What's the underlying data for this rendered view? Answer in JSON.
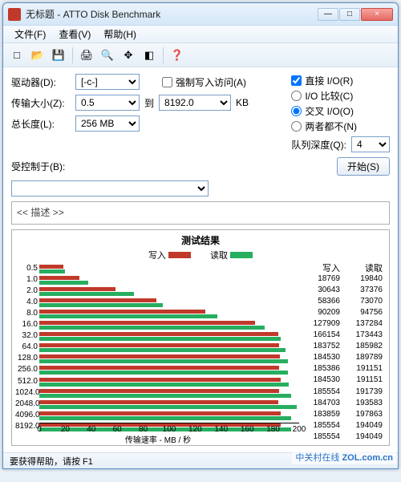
{
  "window": {
    "title": "无标题 - ATTO Disk Benchmark",
    "min": "—",
    "max": "□",
    "close": "×"
  },
  "menu": {
    "file": "文件(F)",
    "view": "查看(V)",
    "help": "帮助(H)"
  },
  "toolbar_icons": {
    "new": "□",
    "open": "📂",
    "save": "💾",
    "print": "🖨",
    "preview": "🔍",
    "move": "✥",
    "unknown": "◧",
    "about": "❓"
  },
  "form": {
    "drive_lbl": "驱动器(D):",
    "drive_val": "[-c-]",
    "xfer_lbl": "传输大小(Z):",
    "xfer_from": "0.5",
    "to_lbl": "到",
    "xfer_to": "8192.0",
    "xfer_unit": "KB",
    "len_lbl": "总长度(L):",
    "len_val": "256 MB",
    "force_write": "强制写入访问(A)",
    "direct_io": "直接 I/O(R)",
    "io_compare": "I/O 比较(C)",
    "overlapped": "交叉 I/O(O)",
    "neither": "两者都不(N)",
    "queue_lbl": "队列深度(Q):",
    "queue_val": "4",
    "controlled_lbl": "受控制于(B):",
    "controlled_val": "",
    "start_btn": "开始(S)",
    "desc_placeholder": "<< 描述 >>"
  },
  "results": {
    "title": "测试结果",
    "legend_write": "写入",
    "legend_read": "读取",
    "col_write": "写入",
    "col_read": "读取",
    "xlabel": "传输速率 - MB / 秒"
  },
  "chart_data": {
    "type": "bar",
    "xlabel": "传输速率 - MB / 秒",
    "xlim": [
      0,
      200
    ],
    "xticks": [
      0,
      20,
      40,
      60,
      80,
      100,
      120,
      140,
      160,
      180,
      200
    ],
    "categories": [
      "0.5",
      "1.0",
      "2.0",
      "4.0",
      "8.0",
      "16.0",
      "32.0",
      "64.0",
      "128.0",
      "256.0",
      "512.0",
      "1024.0",
      "2048.0",
      "4096.0",
      "8192.0"
    ],
    "series": [
      {
        "name": "写入",
        "color": "#c0392b",
        "values": [
          18.769,
          30.643,
          58.366,
          90.209,
          127.909,
          166.154,
          183.752,
          184.53,
          185.386,
          184.53,
          185.554,
          184.703,
          183.859,
          185.554,
          185.554
        ]
      },
      {
        "name": "读取",
        "color": "#27ae60",
        "values": [
          19.84,
          37.376,
          73.07,
          94.756,
          137.284,
          173.443,
          185.982,
          189.789,
          191.151,
          191.151,
          191.739,
          193.583,
          197.863,
          194.049,
          194.049
        ]
      }
    ],
    "table": {
      "write": [
        18769,
        30643,
        58366,
        90209,
        127909,
        166154,
        183752,
        184530,
        185386,
        184530,
        185554,
        184703,
        183859,
        185554,
        185554
      ],
      "read": [
        19840,
        37376,
        73070,
        94756,
        137284,
        173443,
        185982,
        189789,
        191151,
        191151,
        191739,
        193583,
        197863,
        194049,
        194049
      ]
    }
  },
  "status": "要获得帮助，请按 F1",
  "watermark": {
    "site": "中关村在线",
    "url": "ZOL.com.cn"
  }
}
